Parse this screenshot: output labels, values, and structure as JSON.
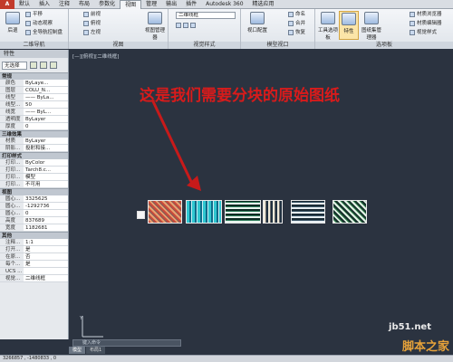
{
  "menubar": {
    "app": "A",
    "tabs": [
      "默认",
      "插入",
      "注释",
      "布局",
      "参数化",
      "视图",
      "管理",
      "输出",
      "插件",
      "Autodesk 360",
      "精选应用"
    ],
    "active_tab": "视图"
  },
  "ribbon": {
    "nav2d": {
      "title": "二维导航",
      "back": "后退",
      "pan": "平移",
      "dyn": "动态观察",
      "full": "全导航控制盘"
    },
    "views": {
      "title": "视图",
      "front": "前视",
      "top": "俯视",
      "left": "左视",
      "manager": "视图管理器"
    },
    "visual": {
      "title": "视觉样式",
      "combo": "二维线框",
      "combo2": "视口配置",
      "combo3": "命名",
      "btn": "视口配置"
    },
    "model": {
      "title": "模型视口",
      "named": "命名",
      "join": "合并",
      "restore": "恢复"
    },
    "palettes": {
      "title": "选项板",
      "tool": "工具选项板",
      "props": "特性",
      "sheet": "图纸集管理器",
      "material": "材质浏览器",
      "material_ed": "材质编辑器",
      "visual_s": "视觉样式"
    }
  },
  "palette": {
    "title": "特性",
    "selection": "无选择",
    "sections": [
      {
        "name": "常规",
        "rows": [
          [
            "颜色",
            "ByLaye..."
          ],
          [
            "图层",
            "COLU_N..."
          ],
          [
            "线型",
            "—— ByLa..."
          ],
          [
            "线型...",
            "50"
          ],
          [
            "线宽",
            "—— ByL..."
          ],
          [
            "透明度",
            "ByLayer"
          ],
          [
            "厚度",
            "0"
          ]
        ]
      },
      {
        "name": "三维效果",
        "rows": [
          [
            "材质",
            "ByLayer"
          ],
          [
            "阴影...",
            "投射和接..."
          ]
        ]
      },
      {
        "name": "打印样式",
        "rows": [
          [
            "打印...",
            "ByColor"
          ],
          [
            "打印...",
            "Tarch8.c..."
          ],
          [
            "打印...",
            "模型"
          ],
          [
            "打印...",
            "不可用"
          ]
        ]
      },
      {
        "name": "视图",
        "rows": [
          [
            "圆心...",
            "3325625"
          ],
          [
            "圆心...",
            "-1292736"
          ],
          [
            "圆心...",
            "0"
          ],
          [
            "高度",
            "837689"
          ],
          [
            "宽度",
            "1182681"
          ]
        ]
      },
      {
        "name": "其他",
        "rows": [
          [
            "注释...",
            "1:1"
          ],
          [
            "打开...",
            "是"
          ],
          [
            "在原...",
            "否"
          ],
          [
            "每个...",
            "是"
          ],
          [
            "UCS ...",
            ""
          ],
          [
            "视觉...",
            "二维线框"
          ]
        ]
      }
    ]
  },
  "canvas": {
    "viewport_label": "[—][俯视][二维线框]",
    "annotation": "这是我们需要分块的原始图纸",
    "command_hint": "键入命令"
  },
  "layout_tabs": [
    "模型",
    "布局1"
  ],
  "status_text": "3266857 , -1480833 , 0",
  "watermark": {
    "site": "jb51.net",
    "brand": "脚本之家"
  },
  "colors": {
    "canvas_bg": "#2b3340",
    "annotation": "#d81b1b",
    "arrow": "#c81a1a"
  }
}
